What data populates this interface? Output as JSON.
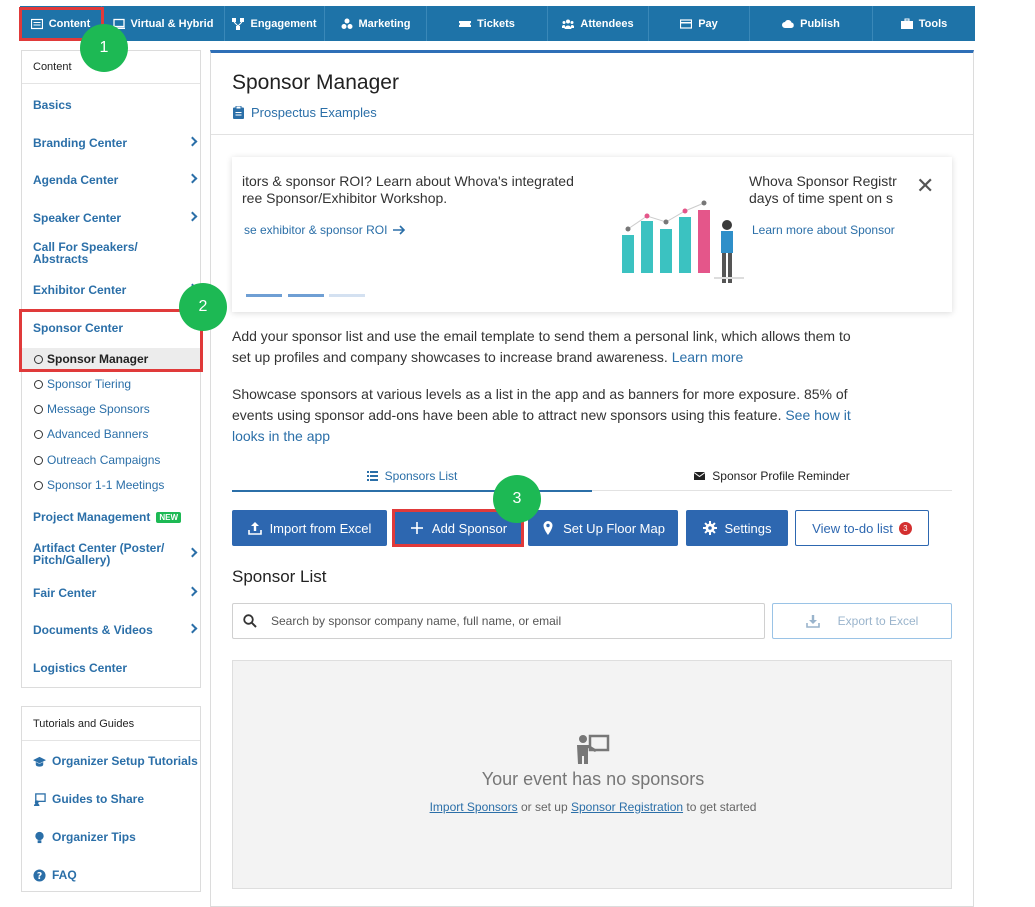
{
  "topnav": {
    "tabs": [
      {
        "label": "Content",
        "icon": "content-icon"
      },
      {
        "label": "Virtual & Hybrid",
        "icon": "monitor-icon"
      },
      {
        "label": "Engagement",
        "icon": "network-icon"
      },
      {
        "label": "Marketing",
        "icon": "marketing-icon"
      },
      {
        "label": "Tickets",
        "icon": "ticket-icon"
      },
      {
        "label": "Attendees",
        "icon": "users-icon"
      },
      {
        "label": "Pay",
        "icon": "credit-card-icon"
      },
      {
        "label": "Publish",
        "icon": "cloud-upload-icon"
      },
      {
        "label": "Tools",
        "icon": "toolbox-icon"
      }
    ]
  },
  "steps": [
    "1",
    "2",
    "3"
  ],
  "sidebar": {
    "header": "Content",
    "items": [
      {
        "label": "Basics"
      },
      {
        "label": "Branding Center"
      },
      {
        "label": "Agenda Center"
      },
      {
        "label": "Speaker Center"
      },
      {
        "label": "Call For Speakers/\nAbstracts"
      },
      {
        "label": "Exhibitor Center"
      },
      {
        "label": "Sponsor Center"
      },
      {
        "label": "Project Management"
      },
      {
        "label": "Artifact Center (Poster/\nPitch/Gallery)"
      },
      {
        "label": "Fair Center"
      },
      {
        "label": "Documents & Videos"
      },
      {
        "label": "Logistics Center"
      }
    ],
    "sponsor_subitems": [
      {
        "label": "Sponsor Manager"
      },
      {
        "label": "Sponsor Tiering"
      },
      {
        "label": "Message Sponsors"
      },
      {
        "label": "Advanced Banners"
      },
      {
        "label": "Outreach Campaigns"
      },
      {
        "label": "Sponsor 1-1 Meetings"
      }
    ],
    "new_badge": "NEW"
  },
  "tutorials": {
    "header": "Tutorials and Guides",
    "items": [
      {
        "label": "Organizer Setup Tutorials",
        "icon": "graduation-cap-icon"
      },
      {
        "label": "Guides to Share",
        "icon": "share-icon"
      },
      {
        "label": "Organizer Tips",
        "icon": "lightbulb-icon"
      },
      {
        "label": "FAQ",
        "icon": "question-icon"
      }
    ]
  },
  "main": {
    "title": "Sponsor Manager",
    "prospectus_link": "Prospectus Examples",
    "carousel": {
      "left_line1": "itors & sponsor ROI? Learn about Whova's integrated",
      "left_line2": "ree Sponsor/Exhibitor Workshop.",
      "left_link": "se exhibitor & sponsor ROI",
      "right_line1": "Whova Sponsor Registr",
      "right_line2": "days of time spent on s",
      "right_link": "Learn more about Sponsor",
      "close": "✕"
    },
    "para1_text": "Add your sponsor list and use the email template to send them a personal link, which allows them to set up profiles and company showcases to increase brand awareness. ",
    "para1_link": "Learn more",
    "para2_text": "Showcase sponsors at various levels as a list in the app and as banners for more exposure. 85% of events using sponsor add-ons have been able to attract new sponsors using this feature. ",
    "para2_link": "See how it looks in the app",
    "tabs": [
      {
        "label": "Sponsors List"
      },
      {
        "label": "Sponsor Profile Reminder"
      }
    ],
    "buttons": {
      "import": "Import from Excel",
      "add": "Add Sponsor",
      "floor": "Set Up Floor Map",
      "settings": "Settings",
      "todo": "View to-do list",
      "todo_count": "3"
    },
    "list_title": "Sponsor List",
    "search_placeholder": "Search by sponsor company name, full name, or email",
    "export": "Export to Excel",
    "empty": {
      "title": "Your event has no sponsors",
      "link1": "Import Sponsors",
      "mid": " or set up ",
      "link2": "Sponsor Registration",
      "end": " to get started"
    }
  },
  "colors": {
    "nav_bg": "#1e73a8",
    "primary": "#2d67b0",
    "highlight": "#e03a3a",
    "step": "#1db954",
    "link": "#2b6fa8"
  }
}
